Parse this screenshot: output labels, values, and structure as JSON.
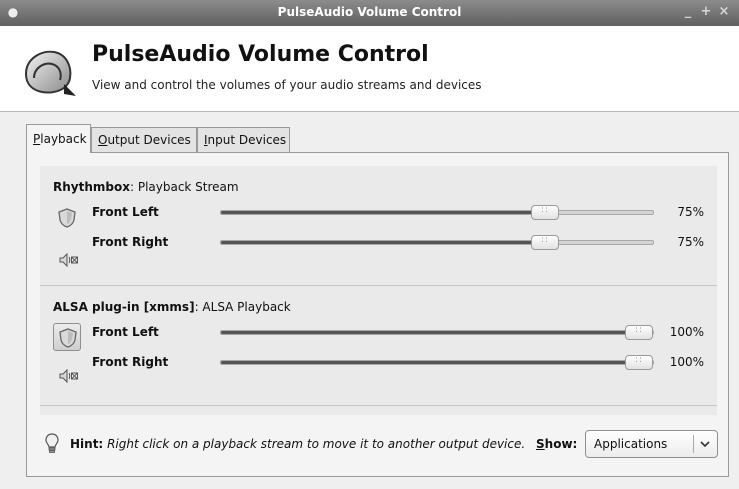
{
  "window": {
    "title": "PulseAudio Volume Control",
    "controls": {
      "minimize": "_",
      "maximize": "+",
      "close": "×"
    }
  },
  "header": {
    "title": "PulseAudio Volume Control",
    "subtitle": "View and control the volumes of your audio streams and devices",
    "icon": "pulseaudio-logo"
  },
  "tabs": [
    {
      "mnemonic": "P",
      "rest": "layback",
      "label": "Playback",
      "active": true
    },
    {
      "mnemonic": "O",
      "rest": "utput Devices",
      "label": "Output Devices",
      "active": false
    },
    {
      "mnemonic": "I",
      "rest": "nput Devices",
      "label": "Input Devices",
      "active": false
    }
  ],
  "streams": [
    {
      "app": "Rhythmbox",
      "description": ": Playback Stream",
      "lock_pressed": false,
      "channels": [
        {
          "label": "Front Left",
          "percent_text": "75%",
          "level": 0.75
        },
        {
          "label": "Front Right",
          "percent_text": "75%",
          "level": 0.75
        }
      ]
    },
    {
      "app": "ALSA plug-in [xmms]",
      "description": ": ALSA Playback",
      "lock_pressed": true,
      "channels": [
        {
          "label": "Front Left",
          "percent_text": "100%",
          "level": 1.0
        },
        {
          "label": "Front Right",
          "percent_text": "100%",
          "level": 1.0
        }
      ]
    }
  ],
  "footer": {
    "hint_label": "Hint:",
    "hint_text": "Right click on a playback stream to move it to another output device.",
    "show_mnemonic": "S",
    "show_rest": "how:",
    "show_selected": "Applications"
  },
  "colors": {
    "titlebar": "#6f6f6f",
    "slider_fill": "#555555",
    "background": "#efefef"
  },
  "icons": {
    "lock": "shield-lock-icon",
    "speaker": "speaker-mute-icon",
    "hint": "lightbulb-icon",
    "dropdown": "chevron-down-icon"
  }
}
